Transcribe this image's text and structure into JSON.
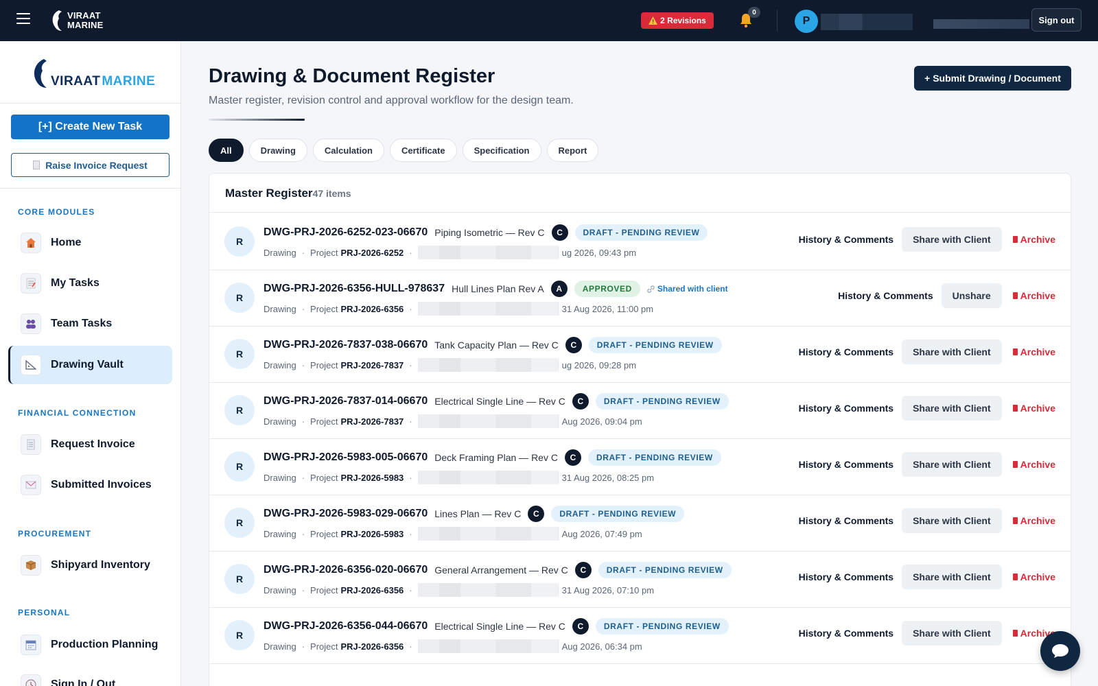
{
  "topbar": {
    "logo_line1": "VIRAAT",
    "logo_line2": "MARINE",
    "revisions_label": "2 Revisions",
    "notification_count": "0",
    "avatar_initial": "P",
    "signout_label": "Sign out"
  },
  "sidebar": {
    "logo_word1": "VIRAAT",
    "logo_word2": "MARINE",
    "create_task_label": "[+] Create New Task",
    "raise_invoice_label": "Raise Invoice Request",
    "sections": {
      "core": "CORE MODULES",
      "financial": "FINANCIAL CONNECTION",
      "procurement": "PROCUREMENT",
      "personal": "PERSONAL"
    },
    "items": {
      "home": "Home",
      "my_tasks": "My Tasks",
      "team_tasks": "Team Tasks",
      "drawing_vault": "Drawing Vault",
      "request_invoice": "Request Invoice",
      "submitted_invoices": "Submitted Invoices",
      "shipyard_inventory": "Shipyard Inventory",
      "production_planning": "Production Planning",
      "sign_in_out": "Sign In / Out"
    }
  },
  "main": {
    "title": "Drawing & Document Register",
    "subtitle": "Master register, revision control and approval workflow for the design team.",
    "submit_label": "+ Submit Drawing / Document",
    "filters": [
      "All",
      "Drawing",
      "Calculation",
      "Certificate",
      "Specification",
      "Report"
    ],
    "panel_title": "Master Register",
    "panel_count": "47 items",
    "actions": {
      "history": "History & Comments",
      "share": "Share with Client",
      "unshare": "Unshare",
      "archive": "Archive"
    },
    "rows": [
      {
        "avatar": "R",
        "code": "DWG-PRJ-2026-6252-023-06670",
        "title": "Piping Isometric — Rev C",
        "rev": "C",
        "status": "DRAFT - PENDING REVIEW",
        "type": "Drawing",
        "project_label": "Project",
        "project": "PRJ-2026-6252",
        "date": "ug 2026, 09:43 pm",
        "shared": ""
      },
      {
        "avatar": "R",
        "code": "DWG-PRJ-2026-6356-HULL-978637",
        "title": "Hull Lines Plan Rev A",
        "rev": "A",
        "status": "APPROVED",
        "type": "Drawing",
        "project_label": "Project",
        "project": "PRJ-2026-6356",
        "date": "31 Aug 2026, 11:00 pm",
        "shared": "Shared with client"
      },
      {
        "avatar": "R",
        "code": "DWG-PRJ-2026-7837-038-06670",
        "title": "Tank Capacity Plan — Rev C",
        "rev": "C",
        "status": "DRAFT - PENDING REVIEW",
        "type": "Drawing",
        "project_label": "Project",
        "project": "PRJ-2026-7837",
        "date": "ug 2026, 09:28 pm",
        "shared": ""
      },
      {
        "avatar": "R",
        "code": "DWG-PRJ-2026-7837-014-06670",
        "title": "Electrical Single Line — Rev C",
        "rev": "C",
        "status": "DRAFT - PENDING REVIEW",
        "type": "Drawing",
        "project_label": "Project",
        "project": "PRJ-2026-7837",
        "date": "Aug 2026, 09:04 pm",
        "shared": ""
      },
      {
        "avatar": "R",
        "code": "DWG-PRJ-2026-5983-005-06670",
        "title": "Deck Framing Plan — Rev C",
        "rev": "C",
        "status": "DRAFT - PENDING REVIEW",
        "type": "Drawing",
        "project_label": "Project",
        "project": "PRJ-2026-5983",
        "date": "31 Aug 2026, 08:25 pm",
        "shared": ""
      },
      {
        "avatar": "R",
        "code": "DWG-PRJ-2026-5983-029-06670",
        "title": "Lines Plan — Rev C",
        "rev": "C",
        "status": "DRAFT - PENDING REVIEW",
        "type": "Drawing",
        "project_label": "Project",
        "project": "PRJ-2026-5983",
        "date": "Aug 2026, 07:49 pm",
        "shared": ""
      },
      {
        "avatar": "R",
        "code": "DWG-PRJ-2026-6356-020-06670",
        "title": "General Arrangement — Rev C",
        "rev": "C",
        "status": "DRAFT - PENDING REVIEW",
        "type": "Drawing",
        "project_label": "Project",
        "project": "PRJ-2026-6356",
        "date": "31 Aug 2026, 07:10 pm",
        "shared": ""
      },
      {
        "avatar": "R",
        "code": "DWG-PRJ-2026-6356-044-06670",
        "title": "Electrical Single Line — Rev C",
        "rev": "C",
        "status": "DRAFT - PENDING REVIEW",
        "type": "Drawing",
        "project_label": "Project",
        "project": "PRJ-2026-6356",
        "date": "Aug 2026, 06:34 pm",
        "shared": ""
      }
    ]
  },
  "colors": {
    "navy": "#0f1b2d",
    "accent_blue": "#1273c7",
    "danger": "#d92b3a",
    "approved_green": "#217a3c"
  }
}
